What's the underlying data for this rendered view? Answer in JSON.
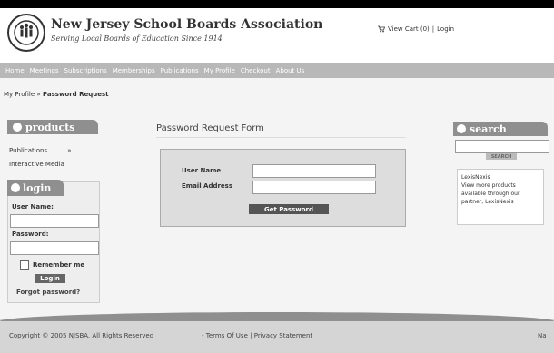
{
  "header": {
    "org_name": "New Jersey School Boards Association",
    "tagline": "Serving Local Boards of Education Since 1914",
    "cart": "View Cart (0)",
    "login": "Login"
  },
  "nav": [
    "Home",
    "Meetings",
    "Subscriptions",
    "Memberships",
    "Publications",
    "My Profile",
    "Checkout",
    "About Us"
  ],
  "breadcrumb": {
    "parent": "My Profile",
    "separator": "»",
    "current": "Password Request"
  },
  "left_sidebar": {
    "products_title": "products",
    "items": [
      {
        "label": "Publications",
        "suffix": "»"
      },
      {
        "label": "Interactive Media"
      }
    ],
    "login_title": "login",
    "username_label": "User Name:",
    "password_label": "Password:",
    "remember_label": "Remember me",
    "login_button": "Login",
    "forgot_link": "Forgot password?"
  },
  "form": {
    "title": "Password Request Form",
    "username_label": "User Name",
    "email_label": "Email Address",
    "submit_label": "Get Password"
  },
  "right_sidebar": {
    "search_title": "search",
    "search_button": "SEARCH",
    "promo_title": "LexisNexis",
    "promo_text": "View more products available through our partner, LexisNexis"
  },
  "footer": {
    "copyright": "Copyright © 2005 NJSBA. All Rights Reserved",
    "terms": "Terms Of Use",
    "privacy": "Privacy Statement",
    "right_text": "Na"
  }
}
